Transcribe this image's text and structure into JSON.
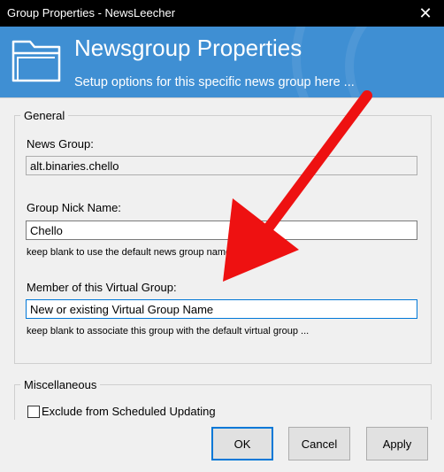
{
  "window": {
    "title": "Group Properties - NewsLeecher",
    "close_glyph": "✕"
  },
  "header": {
    "title": "Newsgroup Properties",
    "subtitle": "Setup options for this specific news group here ..."
  },
  "general": {
    "legend": "General",
    "news_group_label": "News Group:",
    "news_group_value": "alt.binaries.chello",
    "nick_label": "Group Nick Name:",
    "nick_value": "Chello",
    "nick_hint": "keep blank to use the default news group name as nick ...",
    "virtual_label": "Member of this Virtual Group:",
    "virtual_value": "New or existing Virtual Group Name",
    "virtual_hint": "keep blank to associate this group with the default virtual group ..."
  },
  "misc": {
    "legend": "Miscellaneous",
    "exclude_label": "Exclude from Scheduled Updating",
    "exclude_checked": false
  },
  "buttons": {
    "ok": "OK",
    "cancel": "Cancel",
    "apply": "Apply"
  },
  "colors": {
    "header_bg": "#3f8fd3",
    "arrow": "#ee1111",
    "focus": "#0078d7"
  },
  "icons": {
    "header": "folder-icon",
    "close": "close-icon",
    "annotation": "red-arrow-icon"
  }
}
